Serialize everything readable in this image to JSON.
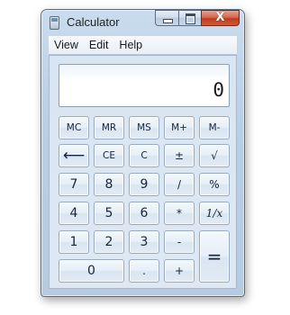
{
  "window": {
    "title": "Calculator",
    "icon": "calculator-icon",
    "close_glyph": "X"
  },
  "menu": [
    "View",
    "Edit",
    "Help"
  ],
  "display": {
    "value": "0"
  },
  "keys": {
    "mc": "MC",
    "mr": "MR",
    "ms": "MS",
    "m_plus": "M+",
    "m_minus": "M-",
    "backspace": "⟵",
    "ce": "CE",
    "c": "C",
    "plus_minus": "±",
    "sqrt": "√",
    "seven": "7",
    "eight": "8",
    "nine": "9",
    "divide": "/",
    "percent": "%",
    "four": "4",
    "five": "5",
    "six": "6",
    "multiply": "*",
    "reciprocal": "1/x",
    "one": "1",
    "two": "2",
    "three": "3",
    "subtract": "-",
    "equals": "=",
    "zero": "0",
    "decimal": ".",
    "add": "+"
  }
}
